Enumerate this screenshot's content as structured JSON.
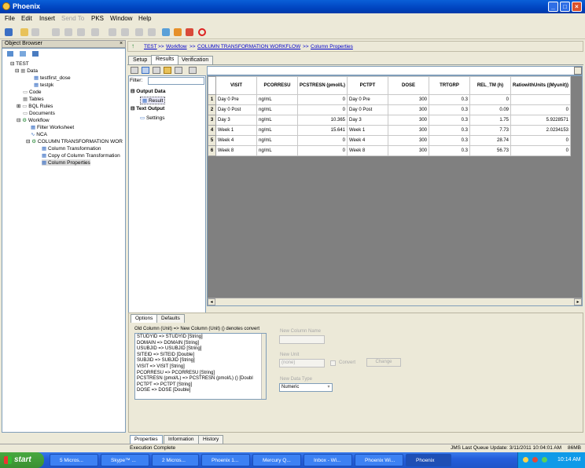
{
  "window": {
    "title": "Phoenix",
    "minimize": "_",
    "maximize": "□",
    "close": "×"
  },
  "menu": [
    "File",
    "Edit",
    "Insert",
    "Send To",
    "PKS",
    "Window",
    "Help"
  ],
  "object_browser": {
    "title": "Object Browser",
    "tree": [
      "TEST",
      "Data",
      "testfirst_dose",
      "testpk",
      "Code",
      "Tables",
      "BQL Rules",
      "Documents",
      "Workflow",
      "Filter Worksheet",
      "NCA",
      "COLUMN TRANSFORMATION WOR",
      "Column Transformation",
      "Copy of Column Transformation",
      "Column Properties"
    ]
  },
  "breadcrumb": [
    "TEST",
    ">>",
    "Workflow",
    ">>",
    "COLUMN TRANSFORMATION WORKFLOW",
    ">>",
    "Column Properties"
  ],
  "tabs": [
    "Setup",
    "Results",
    "Verification"
  ],
  "filter_label": "Filter:",
  "results_tree": [
    "Output Data",
    "Result",
    "Text Output",
    "Settings"
  ],
  "grid": {
    "headers": [
      "VISIT",
      "PCORRESU",
      "PCSTRESN (pmol/L)",
      "PCTPT",
      "DOSE",
      "TRTGRP",
      "REL_TM (h)",
      "RatiowithUnits ((Myunit))"
    ],
    "rows": [
      [
        "1",
        "Day 0 Pre",
        "ng/mL",
        "0",
        "Day 0 Pre",
        "300",
        "0.3",
        "0",
        ""
      ],
      [
        "2",
        "Day 0 Post",
        "ng/mL",
        "0",
        "Day 0 Post",
        "300",
        "0.3",
        "0.09",
        "0"
      ],
      [
        "3",
        "Day 3",
        "ng/mL",
        "10.365",
        "Day 3",
        "300",
        "0.3",
        "1.75",
        "5.9228571"
      ],
      [
        "4",
        "Week 1",
        "ng/mL",
        "15.641",
        "Week 1",
        "300",
        "0.3",
        "7.73",
        "2.0234153"
      ],
      [
        "5",
        "Week 4",
        "ng/mL",
        "0",
        "Week 4",
        "300",
        "0.3",
        "28.74",
        "0"
      ],
      [
        "6",
        "Week 8",
        "ng/mL",
        "0",
        "Week 8",
        "300",
        "0.3",
        "56.73",
        "0"
      ]
    ]
  },
  "options": {
    "tabs": [
      "Options",
      "Defaults"
    ],
    "list_header": "Old Column (Unit) => New Column (Unit) () denotes convert",
    "columns": [
      "STUDYID => STUDYID [String]",
      "DOMAIN => DOMAIN [String]",
      "USUBJID => USUBJID [String]",
      "SITEID => SITEID [Double]",
      "SUBJID => SUBJID [String]",
      "VISIT => VISIT [String]",
      "PCORRESU => PCORRESU [String]",
      "PCSTRESN (pmol/L) => PCSTRESN (pmol/L) () [Doubl",
      "PCTPT => PCTPT [String]",
      "DOSE => DOSE [Double]"
    ],
    "new_column_name_label": "New Column Name",
    "new_unit_label": "New Unit",
    "new_unit_placeholder": "(none)",
    "convert_label": "Convert",
    "change_label": "Change",
    "new_data_type_label": "New Data Type",
    "new_data_type_value": "Numeric"
  },
  "bottom_tabs": [
    "Properties",
    "Information",
    "History"
  ],
  "status": {
    "left": "Execution Complete",
    "right": "JMS Last Queue Update: 3/11/2011 10:04:01 AM",
    "mem": "86MB"
  },
  "taskbar": {
    "start": "start",
    "tasks": [
      "5 Micros...",
      "Skype™ ...",
      "2 Micros...",
      "Phoenix 1...",
      "Mercury Q...",
      "Inbox - Wi...",
      "Phoenix Wi...",
      "Phoenix"
    ],
    "clock": "10:14 AM"
  },
  "colors": {
    "titlebar": "#0a5fd8",
    "start": "#3a8f32",
    "taskbar": "#245edb"
  }
}
